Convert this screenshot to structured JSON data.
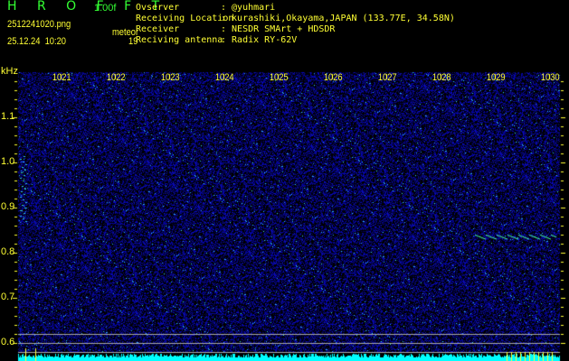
{
  "header": {
    "app_name": "H R O F F T",
    "version": "1.00f",
    "filename": "2512241020.png",
    "datetime": "25.12.24  10:20",
    "meteor_label": "meteor",
    "meteor_count": "19"
  },
  "info": [
    {
      "label": "Ovserver",
      "value": ": @yuhmari"
    },
    {
      "label": "Receiving Location",
      "value": ": kurashiki,Okayama,JAPAN (133.77E, 34.58N)"
    },
    {
      "label": "Receiver",
      "value": ": NESDR SMArt + HDSDR"
    },
    {
      "label": "Reciving antenna",
      "value": ": Radix RY-62V"
    }
  ],
  "spectrogram": {
    "y_unit": "kHz",
    "time_ticks": [
      "1021",
      "1022",
      "1023",
      "1024",
      "1025",
      "1026",
      "1027",
      "1028",
      "1029",
      "1030"
    ],
    "freq_ticks": [
      "1.1",
      "1.0",
      "0.9",
      "0.8",
      "0.7",
      "0.6"
    ],
    "colors": {
      "background": "#000000",
      "noise": "#1a1aff",
      "signal": "#33ffcc",
      "text": "#ffff33",
      "title": "#33ff33"
    }
  }
}
